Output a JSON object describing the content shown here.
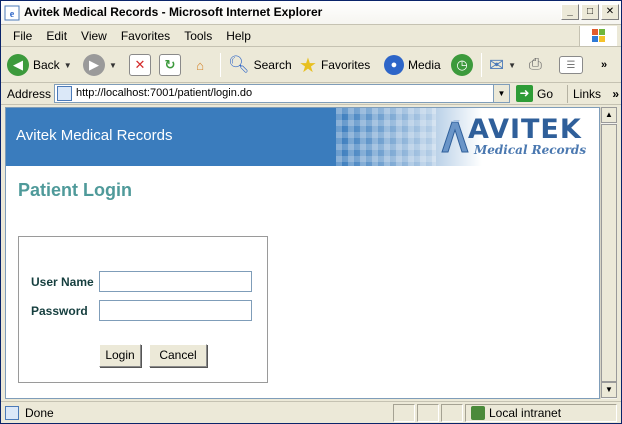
{
  "window": {
    "title": "Avitek Medical Records - Microsoft Internet Explorer",
    "controls": [
      "_",
      "□",
      "✕"
    ]
  },
  "menu": {
    "items": [
      "File",
      "Edit",
      "View",
      "Favorites",
      "Tools",
      "Help"
    ]
  },
  "toolbar": {
    "back_label": "Back",
    "search_label": "Search",
    "favorites_label": "Favorites",
    "media_label": "Media"
  },
  "address": {
    "label": "Address",
    "url": "http://localhost:7001/patient/login.do",
    "go_label": "Go",
    "links_label": "Links"
  },
  "page": {
    "banner_title": "Avitek Medical Records",
    "logo_word": "AVITEK",
    "logo_sub": "Medical Records",
    "heading": "Patient Login",
    "form": {
      "username_label": "User Name",
      "username_value": "",
      "password_label": "Password",
      "password_value": "",
      "login_label": "Login",
      "cancel_label": "Cancel"
    }
  },
  "status": {
    "text": "Done",
    "zone": "Local intranet"
  },
  "colors": {
    "banner": "#3a7cbd",
    "heading": "#4f9a9a",
    "label": "#153e3e"
  }
}
